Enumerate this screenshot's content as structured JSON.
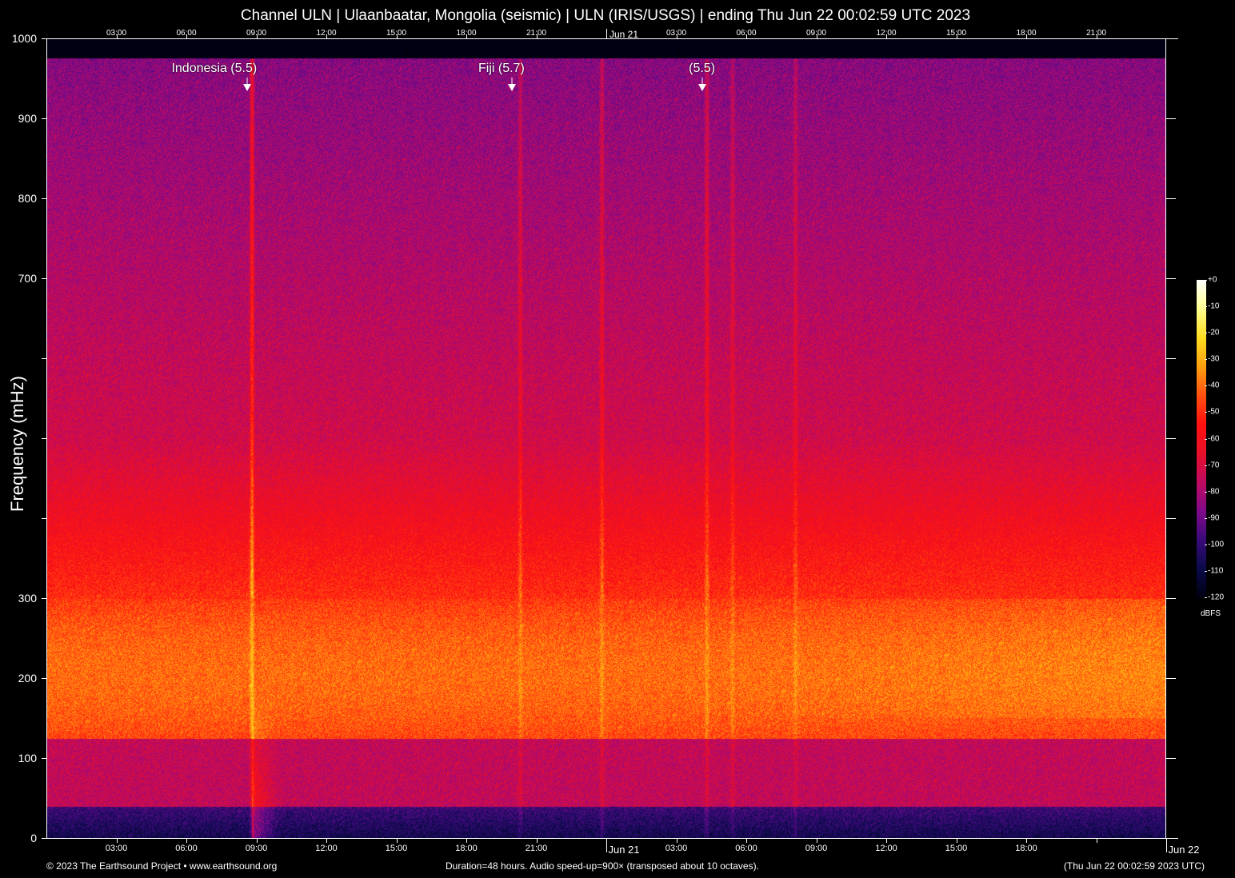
{
  "title": "Channel ULN | Ulaanbaatar, Mongolia (seismic) | ULN (IRIS/USGS) | ending Thu Jun 22 00:02:59 UTC 2023",
  "chart_data": {
    "type": "heatmap",
    "title": "Channel ULN | Ulaanbaatar, Mongolia (seismic) | ULN (IRIS/USGS) | ending Thu Jun 22 00:02:59 UTC 2023",
    "xlabel": "",
    "ylabel": "Frequency (mHz)",
    "x_range_hours": [
      0,
      48
    ],
    "ylim": [
      0,
      1000
    ],
    "y_ticks": [
      0,
      100,
      200,
      300,
      400,
      500,
      600,
      700,
      800,
      900,
      1000
    ],
    "y_tick_labels": [
      "0",
      "100",
      "200",
      "300",
      "",
      "",
      "",
      "700",
      "800",
      "900",
      "1000"
    ],
    "x_ticks_top": [
      {
        "hour": 3,
        "label": "03:00"
      },
      {
        "hour": 6,
        "label": "06:00"
      },
      {
        "hour": 9,
        "label": "09:00"
      },
      {
        "hour": 12,
        "label": "12:00"
      },
      {
        "hour": 15,
        "label": "15:00"
      },
      {
        "hour": 18,
        "label": "18:00"
      },
      {
        "hour": 21,
        "label": "21:00"
      },
      {
        "hour": 24,
        "label": "Jun 21"
      },
      {
        "hour": 27,
        "label": "03:00"
      },
      {
        "hour": 30,
        "label": "06:00"
      },
      {
        "hour": 33,
        "label": "09:00"
      },
      {
        "hour": 36,
        "label": "12:00"
      },
      {
        "hour": 39,
        "label": "15:00"
      },
      {
        "hour": 42,
        "label": "18:00"
      },
      {
        "hour": 45,
        "label": "21:00"
      }
    ],
    "x_ticks_bottom": [
      {
        "hour": 3,
        "label": "03:00"
      },
      {
        "hour": 6,
        "label": "06:00"
      },
      {
        "hour": 9,
        "label": "09:00"
      },
      {
        "hour": 12,
        "label": "12:00"
      },
      {
        "hour": 15,
        "label": "15:00"
      },
      {
        "hour": 18,
        "label": "18:00"
      },
      {
        "hour": 21,
        "label": "21:00"
      },
      {
        "hour": 24,
        "label": "Jun 21"
      },
      {
        "hour": 27,
        "label": "03:00"
      },
      {
        "hour": 30,
        "label": "06:00"
      },
      {
        "hour": 33,
        "label": "09:00"
      },
      {
        "hour": 36,
        "label": "12:00"
      },
      {
        "hour": 39,
        "label": "15:00"
      },
      {
        "hour": 42,
        "label": "18:00"
      },
      {
        "hour": 45,
        "label": ""
      },
      {
        "hour": 48,
        "label": "Jun 22"
      }
    ],
    "annotations": [
      {
        "label": "Indonesia (5.5)",
        "hour": 8.6
      },
      {
        "label": "Fiji (5.7)",
        "hour": 19.95
      },
      {
        "label": "(5.5)",
        "hour": 28.1
      }
    ],
    "signals": [
      {
        "hour": 8.8,
        "strength_db": 28,
        "low_freq_burst": true
      },
      {
        "hour": 20.3,
        "strength_db": 14
      },
      {
        "hour": 23.8,
        "strength_db": 16
      },
      {
        "hour": 28.3,
        "strength_db": 16
      },
      {
        "hour": 29.4,
        "strength_db": 12
      },
      {
        "hour": 32.1,
        "strength_db": 12
      }
    ],
    "colorbar": {
      "label": "dBFS",
      "range": [
        -120,
        0
      ],
      "ticks": [
        "+0",
        "-10",
        "-20",
        "-30",
        "-40",
        "-50",
        "-60",
        "-70",
        "-80",
        "-90",
        "-100",
        "-110",
        "-120"
      ],
      "colors": [
        "#000010",
        "#0a0a4a",
        "#3a0a7a",
        "#800a8a",
        "#c00a60",
        "#e8102a",
        "#ff1010",
        "#ff5010",
        "#ffa010",
        "#ffdd20",
        "#ffff90",
        "#ffffff"
      ]
    }
  },
  "footer": {
    "left": "© 2023 The Earthsound Project • www.earthsound.org",
    "center": "Duration=48 hours. Audio speed-up=900× (transposed about 10 octaves).",
    "right": "(Thu Jun 22 00:02:59 2023 UTC)"
  }
}
